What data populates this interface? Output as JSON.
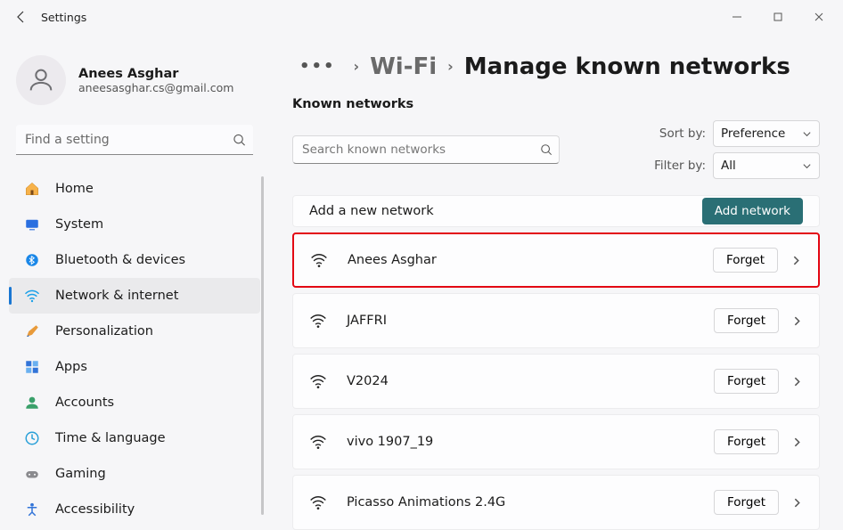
{
  "window": {
    "title": "Settings"
  },
  "user": {
    "name": "Anees Asghar",
    "email": "aneesasghar.cs@gmail.com"
  },
  "sidebar_search": {
    "placeholder": "Find a setting"
  },
  "nav": [
    {
      "label": "Home"
    },
    {
      "label": "System"
    },
    {
      "label": "Bluetooth & devices"
    },
    {
      "label": "Network & internet"
    },
    {
      "label": "Personalization"
    },
    {
      "label": "Apps"
    },
    {
      "label": "Accounts"
    },
    {
      "label": "Time & language"
    },
    {
      "label": "Gaming"
    },
    {
      "label": "Accessibility"
    }
  ],
  "breadcrumb": {
    "mid": "Wi-Fi",
    "current": "Manage known networks"
  },
  "known": {
    "section_label": "Known networks",
    "search_placeholder": "Search known networks",
    "sort_label": "Sort by:",
    "sort_value": "Preference",
    "filter_label": "Filter by:",
    "filter_value": "All",
    "add_label": "Add a new network",
    "add_button": "Add network",
    "forget_label": "Forget"
  },
  "networks": [
    {
      "name": "Anees Asghar",
      "highlight": true
    },
    {
      "name": "JAFFRI"
    },
    {
      "name": "V2024"
    },
    {
      "name": "vivo 1907_19"
    },
    {
      "name": "Picasso Animations 2.4G"
    }
  ]
}
